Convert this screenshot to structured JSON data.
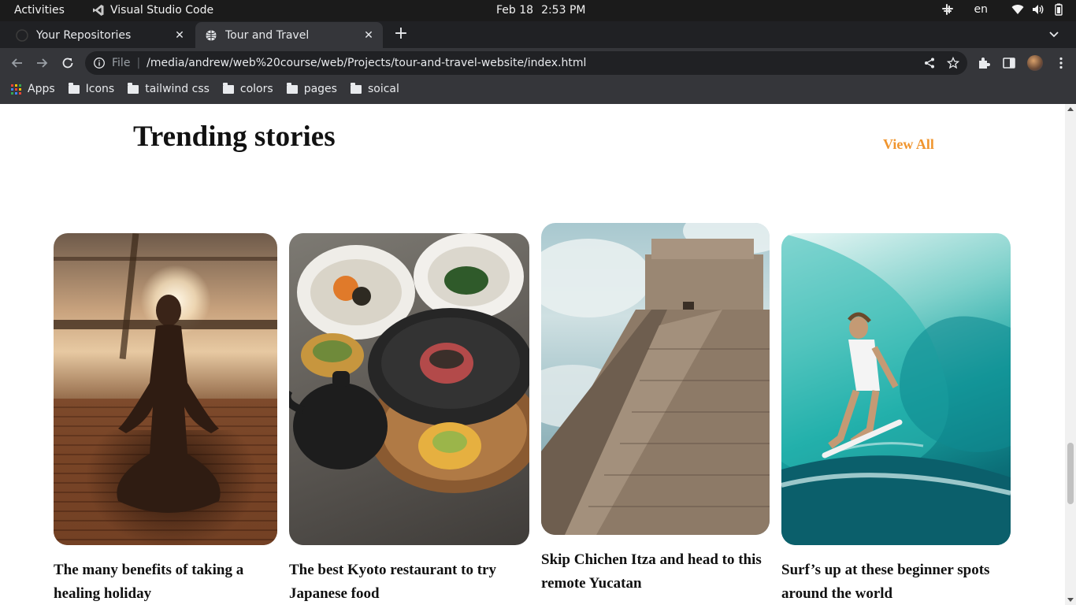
{
  "system_bar": {
    "activities": "Activities",
    "app_name": "Visual Studio Code",
    "date": "Feb 18",
    "time": "2:53 PM",
    "language": "en"
  },
  "tabs": [
    {
      "title": "Your Repositories",
      "favicon": "github-icon"
    },
    {
      "title": "Tour and Travel",
      "favicon": "globe-icon"
    }
  ],
  "toolbar": {
    "scheme_label": "File",
    "url": "/media/andrew/web%20course/web/Projects/tour-and-travel-website/index.html"
  },
  "bookmarks": [
    {
      "label": "Apps",
      "icon": "apps-grid-icon"
    },
    {
      "label": "Icons",
      "icon": "folder-icon"
    },
    {
      "label": "tailwind css",
      "icon": "folder-icon"
    },
    {
      "label": "colors",
      "icon": "folder-icon"
    },
    {
      "label": "pages",
      "icon": "folder-icon"
    },
    {
      "label": "soical",
      "icon": "folder-icon"
    }
  ],
  "page": {
    "section_title": "Trending stories",
    "view_all": "View All",
    "accent_color": "#f0952e",
    "stories": [
      {
        "caption": "The many benefits of taking a healing holiday"
      },
      {
        "caption": "The best Kyoto restaurant to try Japanese food"
      },
      {
        "caption": "Skip Chichen Itza and head to this remote Yucatan"
      },
      {
        "caption": "Surf’s up at these beginner spots around the world"
      }
    ]
  }
}
